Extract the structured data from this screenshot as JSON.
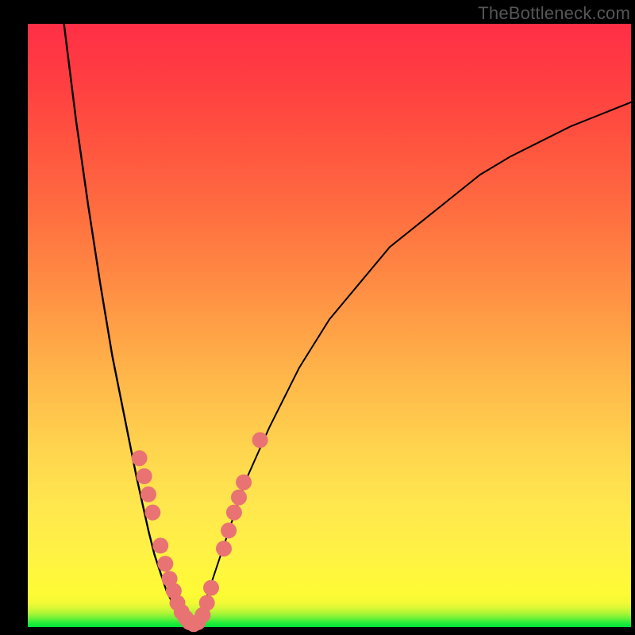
{
  "watermark": "TheBottleneck.com",
  "chart_data": {
    "type": "line",
    "title": "",
    "xlabel": "",
    "ylabel": "",
    "xlim": [
      0,
      100
    ],
    "ylim": [
      0,
      100
    ],
    "grid": false,
    "legend": false,
    "series": [
      {
        "name": "curve-left",
        "x": [
          6,
          8,
          10,
          12,
          14,
          16,
          18,
          20,
          21,
          22,
          23,
          24,
          25,
          26,
          27
        ],
        "y": [
          100,
          84,
          70,
          57,
          45,
          35,
          25,
          16,
          12,
          9,
          6,
          4,
          2,
          1,
          0
        ]
      },
      {
        "name": "curve-right",
        "x": [
          27,
          28,
          29,
          30,
          32,
          34,
          36,
          40,
          45,
          50,
          55,
          60,
          65,
          70,
          75,
          80,
          85,
          90,
          95,
          100
        ],
        "y": [
          0,
          1,
          3,
          6,
          12,
          18,
          24,
          33,
          43,
          51,
          57,
          63,
          67,
          71,
          75,
          78,
          80.5,
          83,
          85,
          87
        ]
      }
    ],
    "markers": [
      {
        "x": 18.5,
        "y": 28
      },
      {
        "x": 19.3,
        "y": 25
      },
      {
        "x": 20.0,
        "y": 22
      },
      {
        "x": 20.7,
        "y": 19
      },
      {
        "x": 22.0,
        "y": 13.5
      },
      {
        "x": 22.8,
        "y": 10.5
      },
      {
        "x": 23.5,
        "y": 8
      },
      {
        "x": 24.2,
        "y": 6
      },
      {
        "x": 24.8,
        "y": 4
      },
      {
        "x": 25.5,
        "y": 2.5
      },
      {
        "x": 26.2,
        "y": 1.5
      },
      {
        "x": 26.8,
        "y": 0.8
      },
      {
        "x": 27.5,
        "y": 0.5
      },
      {
        "x": 28.2,
        "y": 0.8
      },
      {
        "x": 29.0,
        "y": 2
      },
      {
        "x": 29.7,
        "y": 4
      },
      {
        "x": 30.4,
        "y": 6.5
      },
      {
        "x": 32.5,
        "y": 13
      },
      {
        "x": 33.3,
        "y": 16
      },
      {
        "x": 34.2,
        "y": 19
      },
      {
        "x": 35.0,
        "y": 21.5
      },
      {
        "x": 35.8,
        "y": 24
      },
      {
        "x": 38.5,
        "y": 31
      }
    ],
    "marker_radius_px": 10,
    "background_gradient": {
      "bottom": "#00e43c",
      "mid": "#fff244",
      "top": "#ff2f46"
    },
    "curve_color": "#000000",
    "marker_color": "#e97373"
  }
}
